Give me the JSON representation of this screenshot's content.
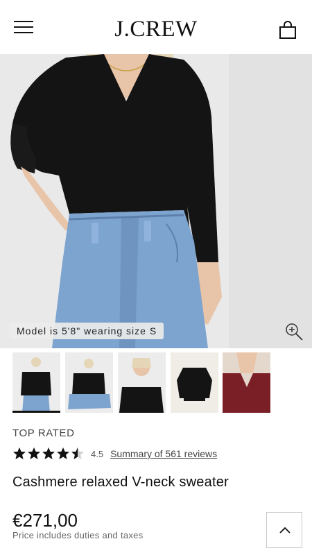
{
  "header": {
    "menu_icon": "hamburger-menu-icon",
    "logo_text": "J.CREW",
    "bag_icon": "shopping-bag-icon"
  },
  "hero": {
    "model_note": "Model is 5'8\" wearing size S",
    "zoom_icon": "zoom-in-icon"
  },
  "thumbnails": [
    {
      "label": "front-on-model",
      "selected": true
    },
    {
      "label": "seated-on-model",
      "selected": false
    },
    {
      "label": "closeup-on-model",
      "selected": false
    },
    {
      "label": "flat-lay",
      "selected": false
    },
    {
      "label": "burgundy-color",
      "selected": false
    }
  ],
  "product": {
    "badge": "TOP RATED",
    "rating": 4.5,
    "rating_text": "4.5",
    "reviews_link": "Summary of 561 reviews",
    "name": "Cashmere relaxed V-neck sweater",
    "price": "€271,00",
    "price_note": "Price includes duties and taxes"
  },
  "back_to_top_icon": "chevron-up-icon",
  "colors": {
    "sweater": "#111111",
    "denim": "#7da3cf",
    "burgundy": "#7a1f26",
    "background": "#e9e9ea"
  }
}
